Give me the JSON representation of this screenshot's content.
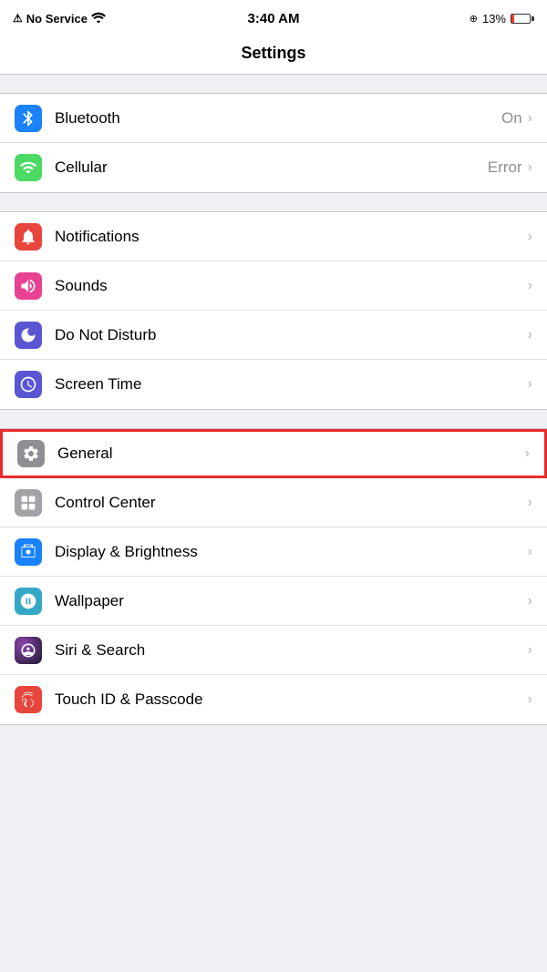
{
  "statusBar": {
    "signal": "No Service",
    "wifi": true,
    "time": "3:40 AM",
    "batteryPercent": "13%",
    "batteryLevel": 13
  },
  "pageTitle": "Settings",
  "groups": [
    {
      "id": "connectivity",
      "rows": [
        {
          "id": "bluetooth",
          "label": "Bluetooth",
          "value": "On",
          "iconBg": "blue",
          "icon": "bluetooth"
        },
        {
          "id": "cellular",
          "label": "Cellular",
          "value": "Error",
          "iconBg": "green",
          "icon": "cellular"
        }
      ]
    },
    {
      "id": "notifications",
      "rows": [
        {
          "id": "notifications",
          "label": "Notifications",
          "value": "",
          "iconBg": "red",
          "icon": "notifications"
        },
        {
          "id": "sounds",
          "label": "Sounds",
          "value": "",
          "iconBg": "pink",
          "icon": "sounds"
        },
        {
          "id": "donotdisturb",
          "label": "Do Not Disturb",
          "value": "",
          "iconBg": "purple",
          "icon": "moon"
        },
        {
          "id": "screentime",
          "label": "Screen Time",
          "value": "",
          "iconBg": "indigo",
          "icon": "screentime"
        }
      ]
    },
    {
      "id": "general",
      "rows": [
        {
          "id": "general",
          "label": "General",
          "value": "",
          "iconBg": "gray",
          "icon": "gear",
          "highlighted": true
        },
        {
          "id": "controlcenter",
          "label": "Control Center",
          "value": "",
          "iconBg": "gray",
          "icon": "controlcenter"
        },
        {
          "id": "displaybrightness",
          "label": "Display & Brightness",
          "value": "",
          "iconBg": "blue2",
          "icon": "display"
        },
        {
          "id": "wallpaper",
          "label": "Wallpaper",
          "value": "",
          "iconBg": "teal",
          "icon": "wallpaper"
        },
        {
          "id": "sirisearch",
          "label": "Siri & Search",
          "value": "",
          "iconBg": "siri",
          "icon": "siri"
        },
        {
          "id": "touchid",
          "label": "Touch ID & Passcode",
          "value": "",
          "iconBg": "red2",
          "icon": "fingerprint"
        }
      ]
    }
  ]
}
